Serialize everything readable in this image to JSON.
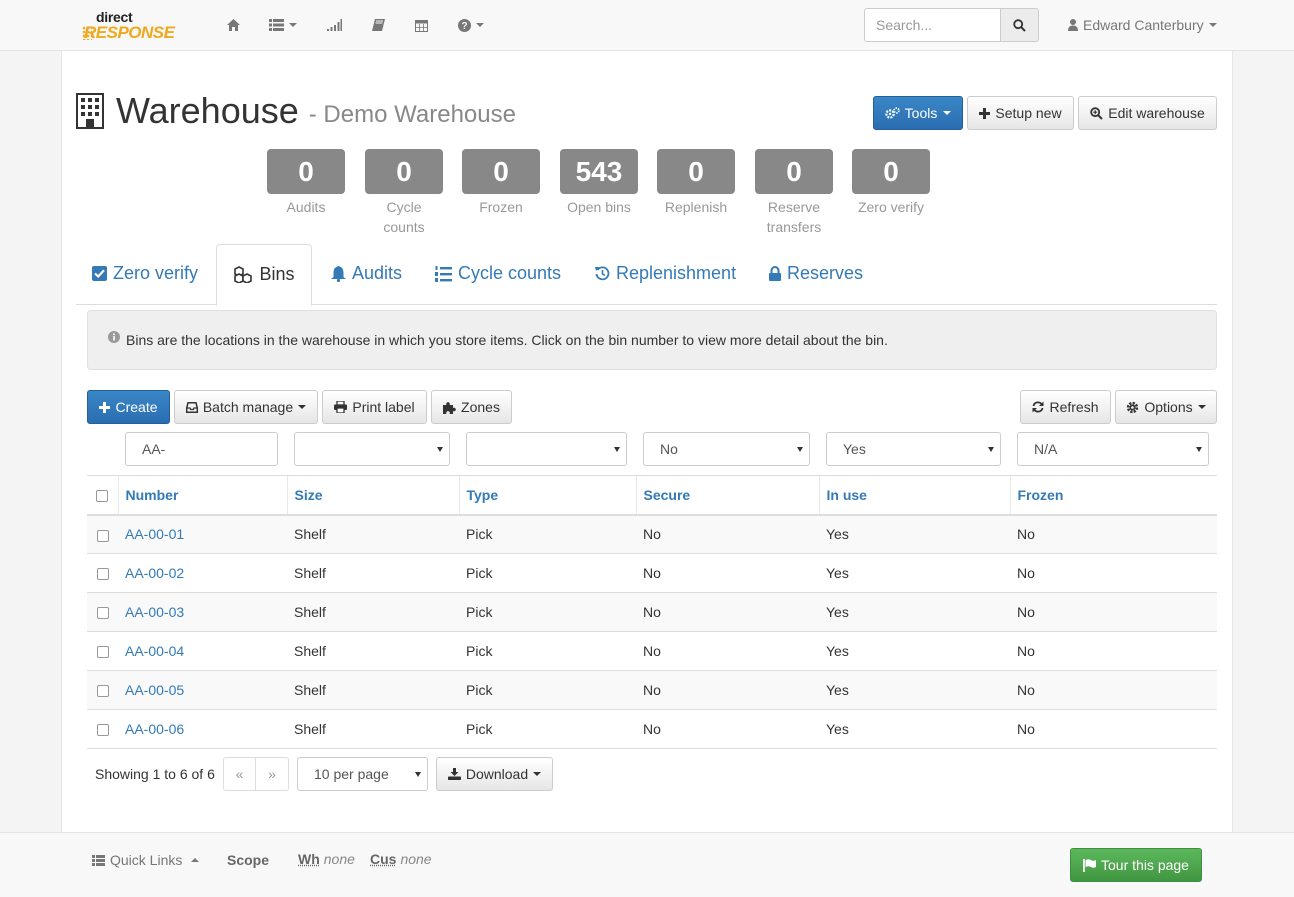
{
  "navbar": {
    "logo_top": "direct",
    "logo_bottom": "RESPONSE",
    "icons": [
      "home-icon",
      "list-icon",
      "signal-icon",
      "book-icon",
      "calendar-icon",
      "question-icon"
    ],
    "search_placeholder": "Search...",
    "user_name": "Edward Canterbury"
  },
  "header": {
    "title": "Warehouse",
    "subtitle": "- Demo Warehouse",
    "tools_label": "Tools",
    "setup_label": "Setup new",
    "edit_label": "Edit warehouse"
  },
  "stats": [
    {
      "value": "0",
      "label": "Audits"
    },
    {
      "value": "0",
      "label": "Cycle counts"
    },
    {
      "value": "0",
      "label": "Frozen"
    },
    {
      "value": "543",
      "label": "Open bins"
    },
    {
      "value": "0",
      "label": "Replenish"
    },
    {
      "value": "0",
      "label": "Reserve transfers"
    },
    {
      "value": "0",
      "label": "Zero verify"
    }
  ],
  "tabs": [
    {
      "label": "Zero verify",
      "icon": "check-square-icon"
    },
    {
      "label": "Bins",
      "icon": "cubes-icon",
      "active": true
    },
    {
      "label": "Audits",
      "icon": "bell-icon"
    },
    {
      "label": "Cycle counts",
      "icon": "list-ol-icon"
    },
    {
      "label": "Replenishment",
      "icon": "history-icon"
    },
    {
      "label": "Reserves",
      "icon": "lock-icon"
    }
  ],
  "info_text": "Bins are the locations in the warehouse in which you store items. Click on the bin number to view more detail about the bin.",
  "toolbar": {
    "create_label": "Create",
    "batch_label": "Batch manage",
    "print_label": "Print label",
    "zones_label": "Zones",
    "refresh_label": "Refresh",
    "options_label": "Options"
  },
  "filters": {
    "number": "AA-",
    "size": "",
    "type": "",
    "secure": "No",
    "in_use": "Yes",
    "frozen": "N/A"
  },
  "table": {
    "columns": [
      "Number",
      "Size",
      "Type",
      "Secure",
      "In use",
      "Frozen"
    ],
    "rows": [
      [
        "AA-00-01",
        "Shelf",
        "Pick",
        "No",
        "Yes",
        "No"
      ],
      [
        "AA-00-02",
        "Shelf",
        "Pick",
        "No",
        "Yes",
        "No"
      ],
      [
        "AA-00-03",
        "Shelf",
        "Pick",
        "No",
        "Yes",
        "No"
      ],
      [
        "AA-00-04",
        "Shelf",
        "Pick",
        "No",
        "Yes",
        "No"
      ],
      [
        "AA-00-05",
        "Shelf",
        "Pick",
        "No",
        "Yes",
        "No"
      ],
      [
        "AA-00-06",
        "Shelf",
        "Pick",
        "No",
        "Yes",
        "No"
      ]
    ]
  },
  "pagination": {
    "showing": "Showing 1 to 6 of 6",
    "prev": "«",
    "next": "»",
    "per_page": "10 per page",
    "download_label": "Download"
  },
  "bottombar": {
    "quick_links": "Quick Links",
    "scope": "Scope",
    "wh_abbr": "Wh",
    "wh_value": "none",
    "cus_abbr": "Cus",
    "cus_value": "none",
    "tour_label": "Tour this page"
  },
  "colors": {
    "primary": "#337ab7",
    "stat_box": "#888888",
    "success": "#5cb85c",
    "logo_orange": "#f0a81c"
  }
}
